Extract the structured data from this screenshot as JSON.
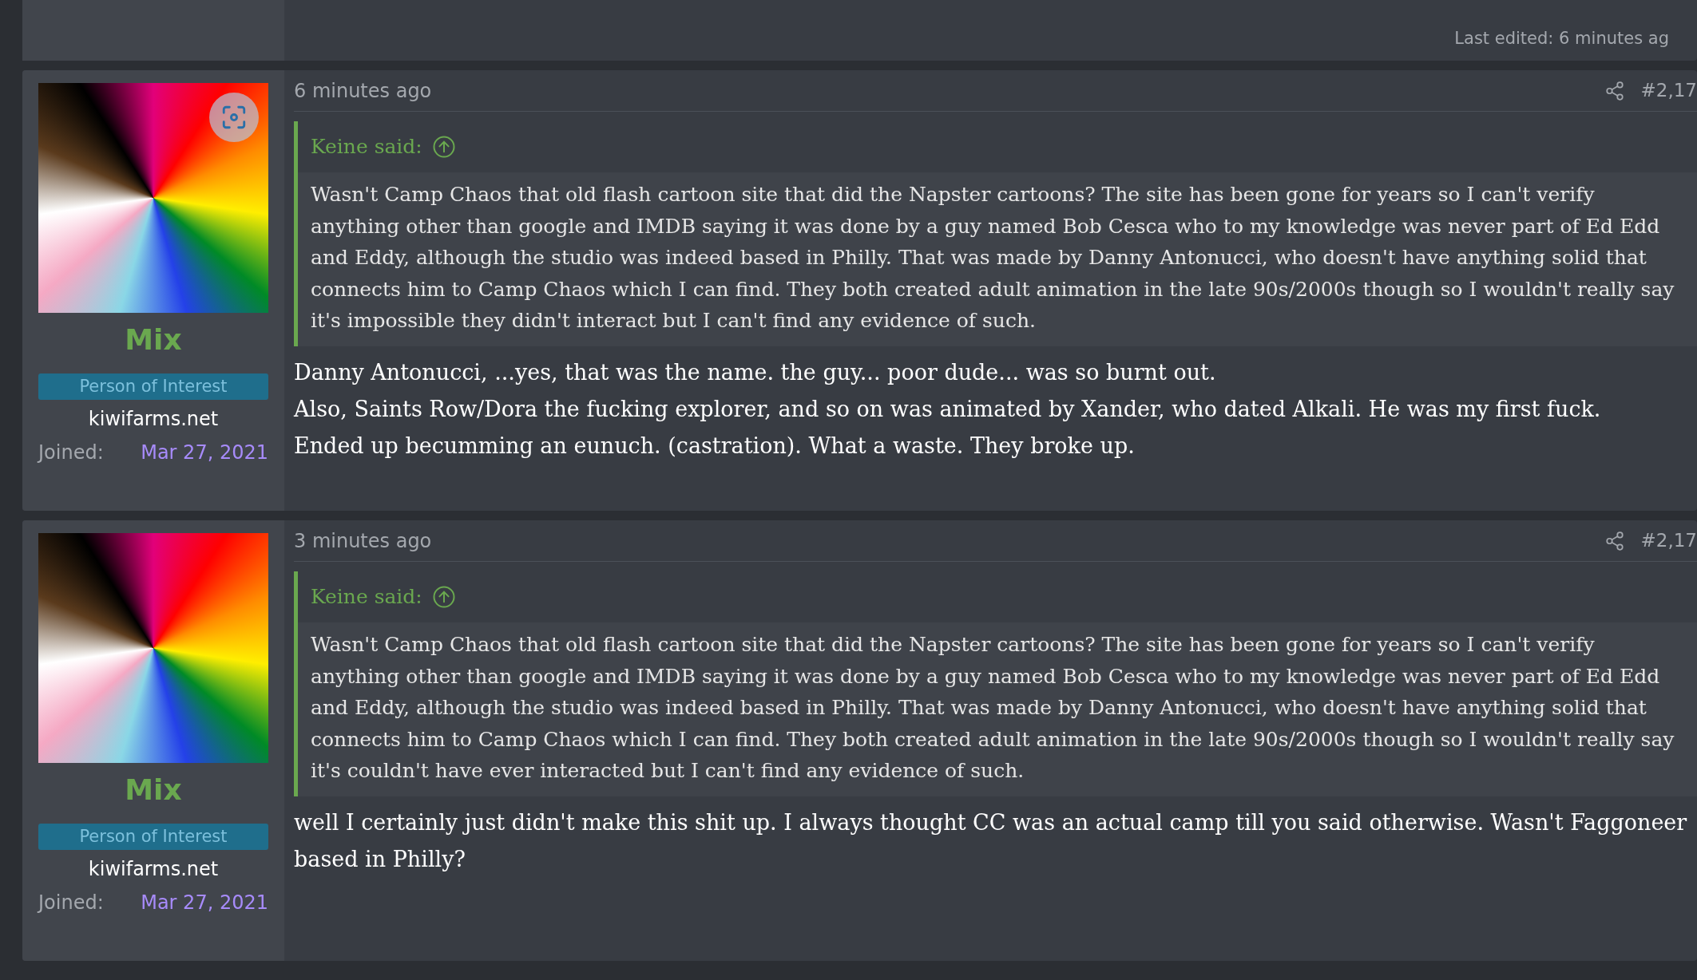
{
  "previous_post": {
    "last_edited": "Last edited: 6 minutes ag"
  },
  "posts": [
    {
      "time": "6 minutes ago",
      "number": "#2,17",
      "avatar_scan_button": true,
      "username": "Mix",
      "role": "Person of Interest",
      "custom_title": "kiwifarms.net",
      "joined_label": "Joined:",
      "joined_date": "Mar 27, 2021",
      "quote": {
        "author": "Keine said:",
        "text": "Wasn't Camp Chaos that old flash cartoon site that did the Napster cartoons? The site has been gone for years so I can't verify anything other than google and IMDB saying it was done by a guy named Bob Cesca who to my knowledge was never part of Ed Edd and Eddy, although the studio was indeed based in Philly. That was made by Danny Antonucci, who doesn't have anything solid that connects him to Camp Chaos which I can find. They both created adult animation in the late 90s/2000s though so I wouldn't really say it's impossible they didn't interact but I can't find any evidence of such."
      },
      "body": [
        "Danny Antonucci, ...yes, that was the name. the guy... poor dude... was so burnt out.",
        "Also, Saints Row/Dora the fucking explorer, and so on was animated by Xander, who dated Alkali. He was my first fuck.",
        "Ended up becumming an eunuch. (castration). What a waste. They broke up."
      ]
    },
    {
      "time": "3 minutes ago",
      "number": "#2,17",
      "avatar_scan_button": false,
      "username": "Mix",
      "role": "Person of Interest",
      "custom_title": "kiwifarms.net",
      "joined_label": "Joined:",
      "joined_date": "Mar 27, 2021",
      "quote": {
        "author": "Keine said:",
        "text": "Wasn't Camp Chaos that old flash cartoon site that did the Napster cartoons? The site has been gone for years so I can't verify anything other than google and IMDB saying it was done by a guy named Bob Cesca who to my knowledge was never part of Ed Edd and Eddy, although the studio was indeed based in Philly. That was made by Danny Antonucci, who doesn't have anything solid that connects him to Camp Chaos which I can find. They both created adult animation in the late 90s/2000s though so I wouldn't really say it's couldn't have ever interacted but I can't find any evidence of such."
      },
      "body": [
        "well I certainly just didn't make this shit up. I always thought CC was an actual camp till you said otherwise. Wasn't Faggoneer based in Philly?"
      ]
    }
  ]
}
